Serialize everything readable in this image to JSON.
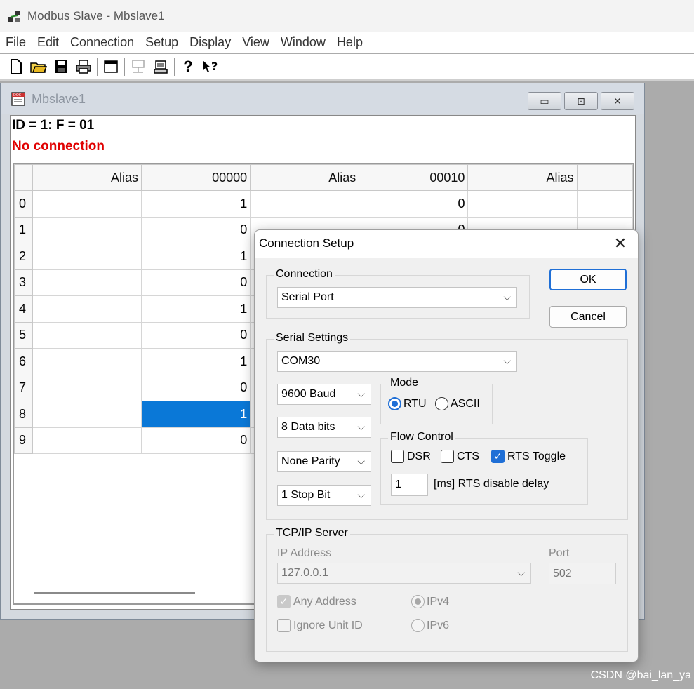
{
  "app": {
    "title": "Modbus Slave - Mbslave1",
    "menu": [
      "File",
      "Edit",
      "Connection",
      "Setup",
      "Display",
      "View",
      "Window",
      "Help"
    ]
  },
  "child": {
    "title": "Mbslave1",
    "info_id": "ID = 1: F = 01",
    "info_status": "No connection",
    "columns": [
      "Alias",
      "00000",
      "Alias",
      "00010",
      "Alias"
    ],
    "rows": [
      {
        "idx": "0",
        "c1": "1",
        "c3": "0"
      },
      {
        "idx": "1",
        "c1": "0",
        "c3": "0"
      },
      {
        "idx": "2",
        "c1": "1",
        "c3": ""
      },
      {
        "idx": "3",
        "c1": "0",
        "c3": ""
      },
      {
        "idx": "4",
        "c1": "1",
        "c3": ""
      },
      {
        "idx": "5",
        "c1": "0",
        "c3": ""
      },
      {
        "idx": "6",
        "c1": "1",
        "c3": ""
      },
      {
        "idx": "7",
        "c1": "0",
        "c3": ""
      },
      {
        "idx": "8",
        "c1": "1",
        "c3": ""
      },
      {
        "idx": "9",
        "c1": "0",
        "c3": ""
      }
    ],
    "selected_row": "8"
  },
  "dialog": {
    "title": "Connection Setup",
    "ok": "OK",
    "cancel": "Cancel",
    "connection": {
      "label": "Connection",
      "value": "Serial Port"
    },
    "serial": {
      "label": "Serial Settings",
      "port": "COM30",
      "baud": "9600 Baud",
      "data_bits": "8 Data bits",
      "parity": "None Parity",
      "stop_bits": "1 Stop Bit"
    },
    "mode": {
      "label": "Mode",
      "rtu": "RTU",
      "ascii": "ASCII",
      "selected": "RTU"
    },
    "flow": {
      "label": "Flow Control",
      "dsr": "DSR",
      "cts": "CTS",
      "rts_toggle": "RTS Toggle",
      "rts_delay_value": "1",
      "rts_delay_label": "[ms] RTS disable delay"
    },
    "tcp": {
      "label": "TCP/IP Server",
      "ip_label": "IP Address",
      "ip_value": "127.0.0.1",
      "port_label": "Port",
      "port_value": "502",
      "any_address": "Any Address",
      "ignore_unit_id": "Ignore Unit ID",
      "ipv4": "IPv4",
      "ipv6": "IPv6"
    }
  },
  "watermark": "CSDN @bai_lan_ya",
  "colors": {
    "accent": "#1f6fd6",
    "selection": "#0a78d7",
    "error": "#e00000"
  }
}
